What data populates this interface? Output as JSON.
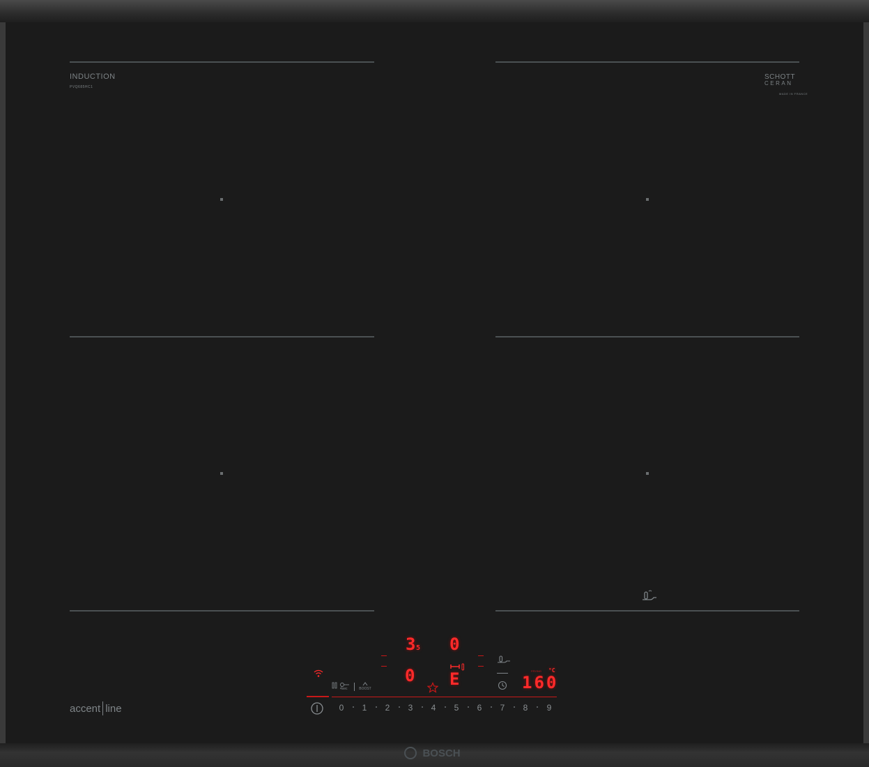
{
  "brand_label": "INDUCTION",
  "model_label": "PVQ685HC1",
  "glass_brand": {
    "line1": "SCHOTT",
    "line2": "CERAN",
    "sub": "MADE IN FRANCE"
  },
  "series_label": {
    "part1": "accent",
    "part2": "line"
  },
  "manufacturer": "BOSCH",
  "displays": {
    "zone_front_left": "0",
    "zone_rear_left": "3",
    "zone_rear_left_sub": "5",
    "zone_rear_right": "0",
    "zone_front_right": "E",
    "temperature_value": "160",
    "temperature_unit": "°C",
    "temperature_label": "FRYING"
  },
  "controls": {
    "lock_label": "4sec",
    "boost_label": "BOOST",
    "power_levels": [
      "0",
      "1",
      "2",
      "3",
      "4",
      "5",
      "6",
      "7",
      "8",
      "9"
    ]
  },
  "icons": {
    "wifi": "wifi-icon",
    "power": "power-icon",
    "lock": "lock-icon",
    "boost": "boost-icon",
    "favourite": "star-icon",
    "timer": "clock-icon",
    "frying_sensor": "pan-sensor-icon",
    "move": "move-icon"
  },
  "colors": {
    "display_red": "#ff2a2a",
    "glass": "#1b1b1b",
    "print": "#7d8386"
  }
}
